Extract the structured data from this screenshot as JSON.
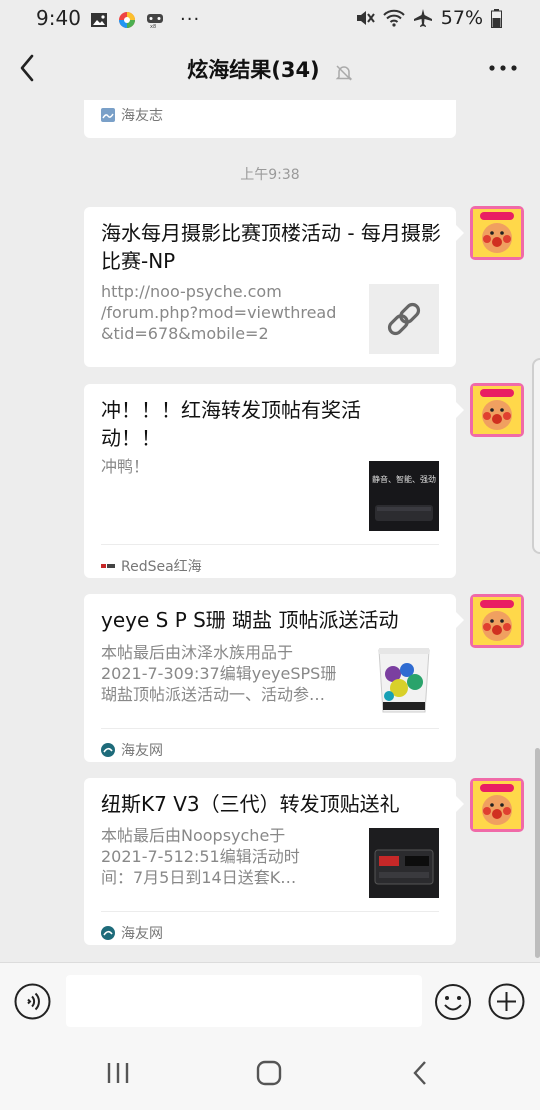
{
  "status_bar": {
    "time": "9:40",
    "dots": "···",
    "battery": "57%"
  },
  "header": {
    "title": "炫海结果(34)"
  },
  "messages": {
    "partial_source": "海友志",
    "timestamp": "上午9:38",
    "cards": [
      {
        "title": "海水每月摄影比赛顶楼活动 - 每月摄影比赛-NP",
        "desc_lines": [
          "http://noo-psyche.com",
          "/forum.php?mod=viewthread",
          "&tid=678&mobile=2"
        ]
      },
      {
        "title": "冲！！！红海转发顶帖有奖活动！！",
        "desc_lines": [
          "冲鸭！"
        ],
        "source": "RedSea红海"
      },
      {
        "title": "yeye S P S珊 瑚盐 顶帖派送活动",
        "desc_lines": [
          "本帖最后由沐泽水族用品于",
          "2021-7-309:37编辑yeyeSPS珊",
          "瑚盐顶帖派送活动一、活动参…"
        ],
        "source": "海友网"
      },
      {
        "title": "纽斯K7 V3（三代）转发顶贴送礼",
        "desc_lines": [
          "本帖最后由Noopsyche于",
          "2021-7-512:51编辑活动时",
          "间：7月5日到14日送套K…"
        ],
        "source": "海友网"
      }
    ]
  },
  "thumbnail_text": {
    "product_banner": "静音、智能、强劲"
  },
  "colors": {
    "background": "#ededed",
    "card": "#ffffff",
    "title_text": "#111111",
    "desc_text": "#888888"
  }
}
